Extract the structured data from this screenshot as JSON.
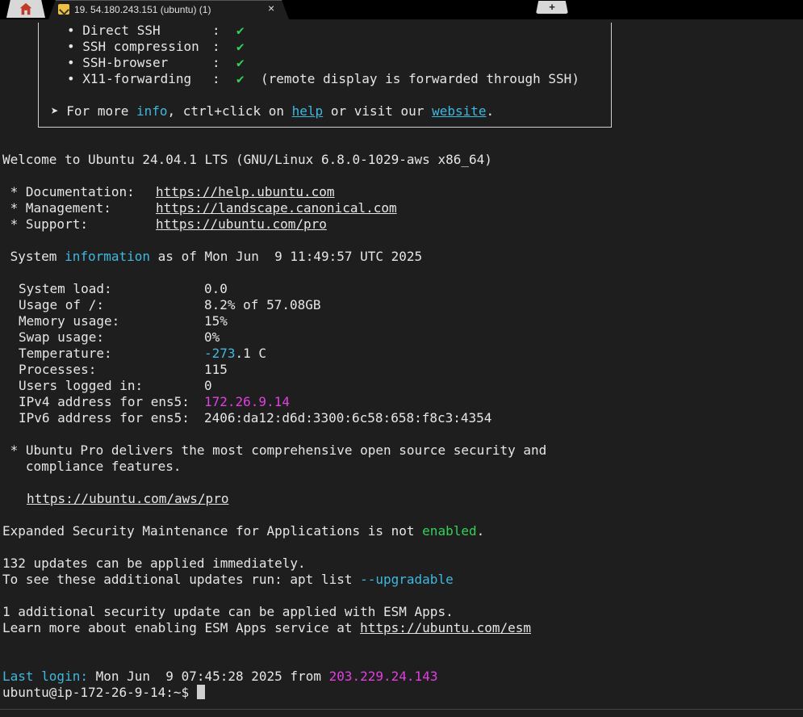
{
  "tabs": {
    "home_icon": "home-icon",
    "session_title": "19. 54.180.243.151 (ubuntu) (1)",
    "close_glyph": "×",
    "new_tab_glyph": "+"
  },
  "banner": {
    "features": [
      {
        "label": "Direct SSH",
        "sep": ":",
        "check": "✔",
        "note": ""
      },
      {
        "label": "SSH compression",
        "sep": ":",
        "check": "✔",
        "note": ""
      },
      {
        "label": "SSH-browser",
        "sep": ":",
        "check": "✔",
        "note": ""
      },
      {
        "label": "X11-forwarding",
        "sep": ":",
        "check": "✔",
        "note": "(remote display is forwarded through SSH)"
      }
    ],
    "more": {
      "arrow": "➤",
      "text1": "For more",
      "info": "info",
      "text2": ", ctrl+click on",
      "help": "help",
      "text3": "or visit our",
      "website": "website",
      "text4": "."
    }
  },
  "welcome": "Welcome to Ubuntu 24.04.1 LTS (GNU/Linux 6.8.0-1029-aws x86_64)",
  "links": [
    {
      "label": " * Documentation:",
      "url": "https://help.ubuntu.com"
    },
    {
      "label": " * Management:",
      "url": "https://landscape.canonical.com"
    },
    {
      "label": " * Support:",
      "url": "https://ubuntu.com/pro"
    }
  ],
  "sysinfo": {
    "pre": " System ",
    "word": "information",
    "post": " as of Mon Jun  9 11:49:57 UTC 2025",
    "rows": [
      {
        "key": "System load:",
        "value": "0.0"
      },
      {
        "key": "Usage of /:",
        "value": "8.2% of 57.08GB"
      },
      {
        "key": "Memory usage:",
        "value": "15%"
      },
      {
        "key": "Swap usage:",
        "value": "0%"
      },
      {
        "key": "Temperature:",
        "value_colored": "-273",
        "value_rest": ".1 C"
      },
      {
        "key": "Processes:",
        "value": "115"
      },
      {
        "key": "Users logged in:",
        "value": "0"
      },
      {
        "key": "IPv4 address for ens5:",
        "value": "172.26.9.14"
      },
      {
        "key": "IPv6 address for ens5:",
        "value": "2406:da12:d6d:3300:6c58:658:f8c3:4354"
      }
    ]
  },
  "pro": {
    "line1": " * Ubuntu Pro delivers the most comprehensive open source security and",
    "line2": "   compliance features.",
    "url": "https://ubuntu.com/aws/pro"
  },
  "esm": {
    "pre": "Expanded Security Maintenance for Applications is not ",
    "word": "enabled",
    "post": "."
  },
  "updates": {
    "line1": "132 updates can be applied immediately.",
    "line2_pre": "To see these additional updates run: apt list ",
    "line2_flag": "--upgradable"
  },
  "security": {
    "line1": "1 additional security update can be applied with ESM Apps.",
    "line2_pre": "Learn more about enabling ESM Apps service at ",
    "line2_url": "https://ubuntu.com/esm"
  },
  "login": {
    "label": "Last login:",
    "when": " Mon Jun  9 07:45:28 2025 from ",
    "ip": "203.229.24.143"
  },
  "prompt": "ubuntu@ip-172-26-9-14:~$ ",
  "colors": {
    "background": "#1e1e1e",
    "cyan": "#3fb8e0",
    "green": "#34d058",
    "magenta": "#e23fe0"
  }
}
